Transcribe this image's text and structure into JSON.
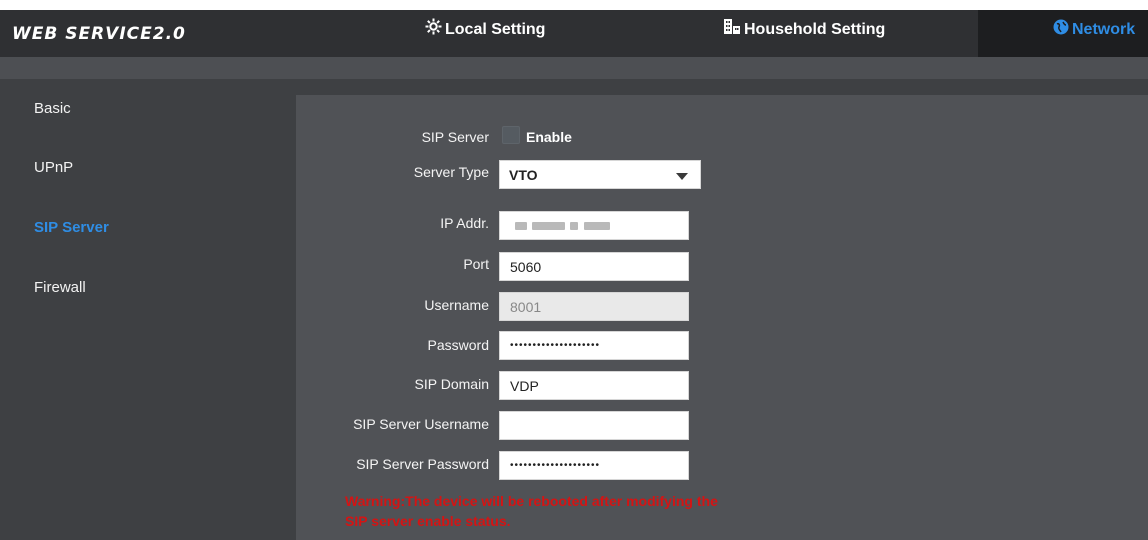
{
  "header": {
    "logo": "WEB SERVICE2.0",
    "nav": [
      {
        "label": "Local Setting",
        "icon": "gear-icon"
      },
      {
        "label": "Household Setting",
        "icon": "building-icon"
      },
      {
        "label": "Network",
        "icon": "globe-icon",
        "active": true
      }
    ]
  },
  "sidebar": {
    "items": [
      {
        "label": "Basic"
      },
      {
        "label": "UPnP"
      },
      {
        "label": "SIP Server",
        "active": true
      },
      {
        "label": "Firewall"
      }
    ]
  },
  "form": {
    "sip_server_label": "SIP Server",
    "enable_label": "Enable",
    "server_type_label": "Server Type",
    "server_type_value": "VTO",
    "ip_label": "IP Addr.",
    "port_label": "Port",
    "port_value": "5060",
    "username_label": "Username",
    "username_value": "8001",
    "password_label": "Password",
    "password_value": "••••••••••••••••••••",
    "sip_domain_label": "SIP Domain",
    "sip_domain_value": "VDP",
    "sip_server_username_label": "SIP Server Username",
    "sip_server_username_value": "",
    "sip_server_password_label": "SIP Server Password",
    "sip_server_password_value": "••••••••••••••••••••",
    "warning_line1": "Warning:The device will be rebooted after modifying the",
    "warning_line2": "SIP server enable status."
  },
  "colors": {
    "accent": "#2f8de4",
    "warning": "#d41414"
  }
}
